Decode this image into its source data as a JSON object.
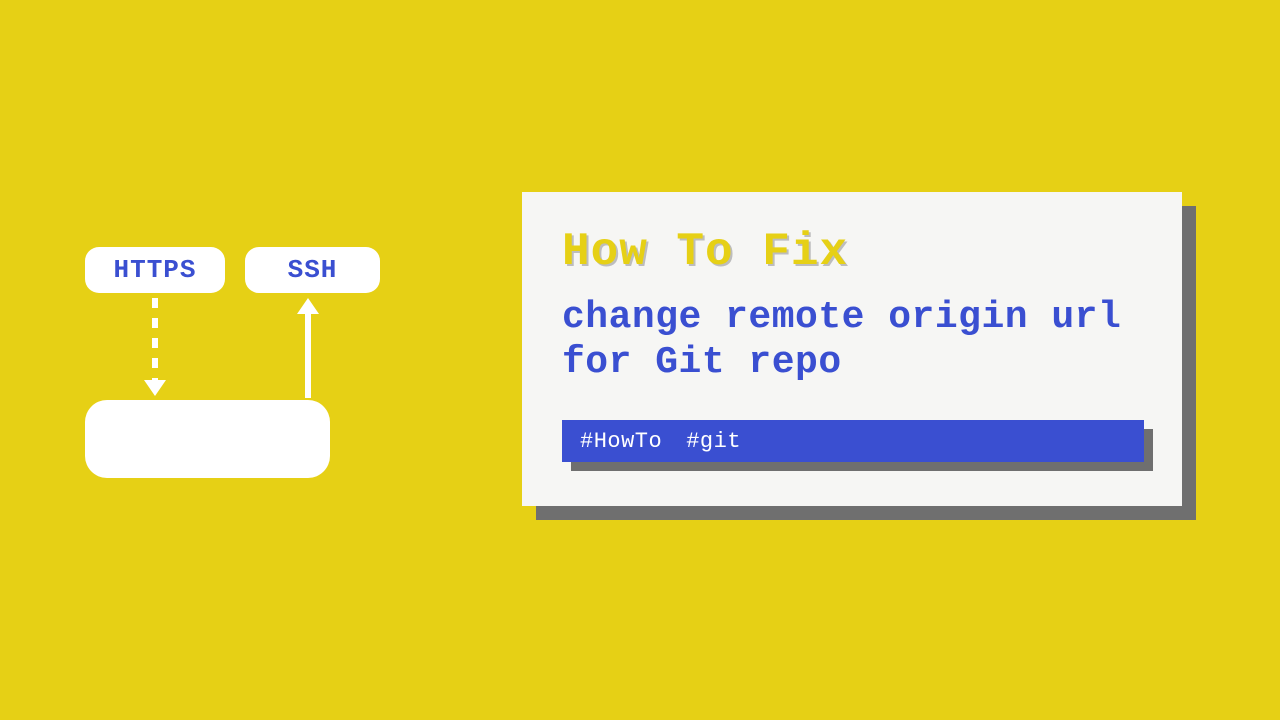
{
  "diagram": {
    "https_label": "HTTPS",
    "ssh_label": "SSH"
  },
  "card": {
    "title": "How To Fix",
    "subtitle": "change remote origin url for Git repo",
    "tags": [
      "#HowTo",
      "#git"
    ]
  },
  "colors": {
    "background": "#e6d015",
    "accent_blue": "#3a4fd1",
    "card_bg": "#f6f6f4",
    "shadow": "#6f6f6f",
    "white": "#ffffff"
  }
}
